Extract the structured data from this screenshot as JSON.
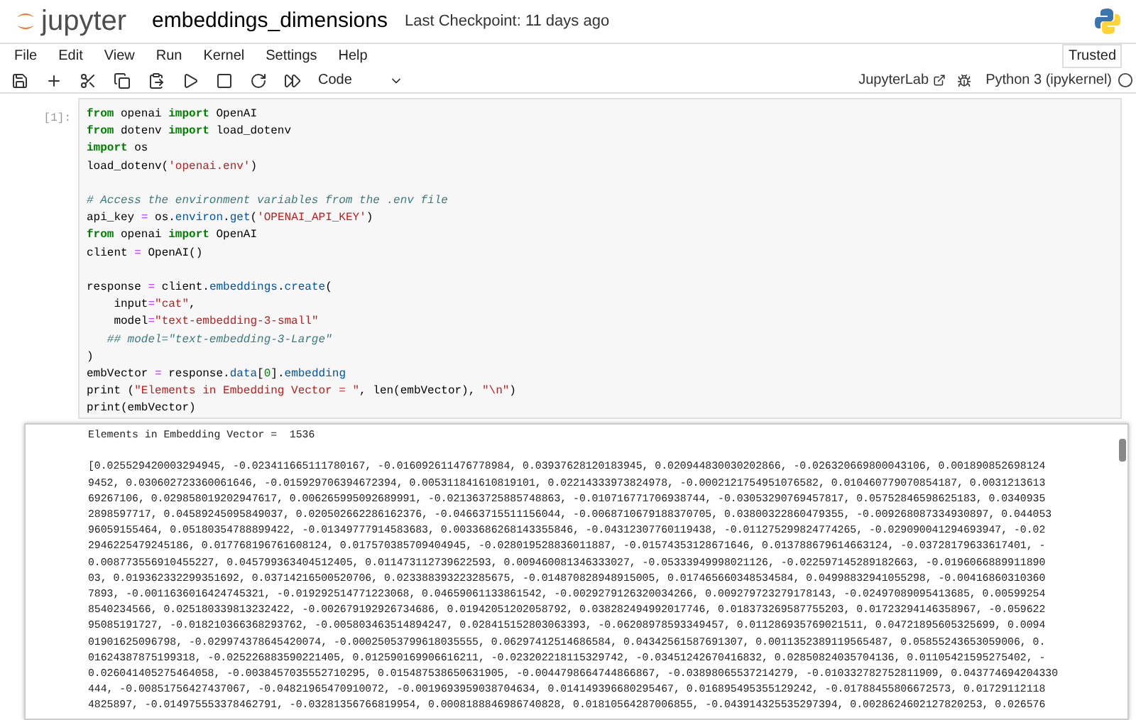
{
  "header": {
    "logo_text": "jupyter",
    "notebook_title": "embeddings_dimensions",
    "checkpoint": "Last Checkpoint: 11 days ago"
  },
  "menu": [
    "File",
    "Edit",
    "View",
    "Run",
    "Kernel",
    "Settings",
    "Help"
  ],
  "trusted": "Trusted",
  "toolbar": {
    "cell_type": "Code",
    "jupyterlab": "JupyterLab",
    "kernel": "Python 3 (ipykernel)"
  },
  "cell": {
    "prompt": "[1]:",
    "lines": [
      {
        "kind": "code",
        "tokens": [
          {
            "text": "from",
            "kind": "kw"
          },
          {
            "text": " openai ",
            "kind": "plain"
          },
          {
            "text": "import",
            "kind": "kw"
          },
          {
            "text": " OpenAI",
            "kind": "plain"
          }
        ]
      },
      {
        "kind": "code",
        "tokens": [
          {
            "text": "from",
            "kind": "kw"
          },
          {
            "text": " dotenv ",
            "kind": "plain"
          },
          {
            "text": "import",
            "kind": "kw"
          },
          {
            "text": " load_dotenv",
            "kind": "plain"
          }
        ]
      },
      {
        "kind": "code",
        "tokens": [
          {
            "text": "import",
            "kind": "kw"
          },
          {
            "text": " os",
            "kind": "plain"
          }
        ]
      },
      {
        "kind": "code",
        "tokens": [
          {
            "text": "load_dotenv(",
            "kind": "plain"
          },
          {
            "text": "'openai.env'",
            "kind": "str"
          },
          {
            "text": ")",
            "kind": "plain"
          }
        ]
      },
      {
        "kind": "blank"
      },
      {
        "kind": "code",
        "tokens": [
          {
            "text": "# Access the environment variables from the .env file",
            "kind": "comment"
          }
        ]
      },
      {
        "kind": "code",
        "tokens": [
          {
            "text": "api_key ",
            "kind": "plain"
          },
          {
            "text": "=",
            "kind": "op"
          },
          {
            "text": " os.",
            "kind": "plain"
          },
          {
            "text": "environ",
            "kind": "attr"
          },
          {
            "text": ".",
            "kind": "plain"
          },
          {
            "text": "get",
            "kind": "attr"
          },
          {
            "text": "(",
            "kind": "plain"
          },
          {
            "text": "'OPENAI_API_KEY'",
            "kind": "str"
          },
          {
            "text": ")",
            "kind": "plain"
          }
        ]
      },
      {
        "kind": "code",
        "tokens": [
          {
            "text": "from",
            "kind": "kw"
          },
          {
            "text": " openai ",
            "kind": "plain"
          },
          {
            "text": "import",
            "kind": "kw"
          },
          {
            "text": " OpenAI",
            "kind": "plain"
          }
        ]
      },
      {
        "kind": "code",
        "tokens": [
          {
            "text": "client ",
            "kind": "plain"
          },
          {
            "text": "=",
            "kind": "op"
          },
          {
            "text": " OpenAI()",
            "kind": "plain"
          }
        ]
      },
      {
        "kind": "blank"
      },
      {
        "kind": "code",
        "tokens": [
          {
            "text": "response ",
            "kind": "plain"
          },
          {
            "text": "=",
            "kind": "op"
          },
          {
            "text": " client.",
            "kind": "plain"
          },
          {
            "text": "embeddings",
            "kind": "attr"
          },
          {
            "text": ".",
            "kind": "plain"
          },
          {
            "text": "create",
            "kind": "attr"
          },
          {
            "text": "(",
            "kind": "plain"
          }
        ]
      },
      {
        "kind": "code",
        "tokens": [
          {
            "text": "    input",
            "kind": "plain"
          },
          {
            "text": "=",
            "kind": "op"
          },
          {
            "text": "\"cat\"",
            "kind": "str"
          },
          {
            "text": ",",
            "kind": "plain"
          }
        ]
      },
      {
        "kind": "code",
        "tokens": [
          {
            "text": "    model",
            "kind": "plain"
          },
          {
            "text": "=",
            "kind": "op"
          },
          {
            "text": "\"text-embedding-3-small\"",
            "kind": "str"
          }
        ]
      },
      {
        "kind": "code",
        "tokens": [
          {
            "text": "   ## model=\"text-embedding-3-Large\"",
            "kind": "comment"
          }
        ]
      },
      {
        "kind": "code",
        "tokens": [
          {
            "text": ")",
            "kind": "plain"
          }
        ]
      },
      {
        "kind": "code",
        "tokens": [
          {
            "text": "embVector ",
            "kind": "plain"
          },
          {
            "text": "=",
            "kind": "op"
          },
          {
            "text": " response.",
            "kind": "plain"
          },
          {
            "text": "data",
            "kind": "attr"
          },
          {
            "text": "[",
            "kind": "plain"
          },
          {
            "text": "0",
            "kind": "num"
          },
          {
            "text": "].",
            "kind": "plain"
          },
          {
            "text": "embedding",
            "kind": "attr"
          }
        ]
      },
      {
        "kind": "code",
        "tokens": [
          {
            "text": "print (",
            "kind": "plain"
          },
          {
            "text": "\"Elements in Embedding Vector = \"",
            "kind": "str"
          },
          {
            "text": ", len(embVector), ",
            "kind": "plain"
          },
          {
            "text": "\"\\n\"",
            "kind": "str"
          },
          {
            "text": ")",
            "kind": "plain"
          }
        ]
      },
      {
        "kind": "code",
        "tokens": [
          {
            "text": "print(embVector)",
            "kind": "plain"
          }
        ]
      }
    ]
  },
  "output": {
    "summary": "Elements in Embedding Vector =  1536",
    "lines": [
      "[0.025529420003294945, -0.023411665111780167, -0.016092611476778984, 0.03937628120183945, 0.020944830030202866, -0.026320669800043106, 0.001890852698124",
      "9452, 0.030602723360061646, -0.015929706394672394, 0.005311841610819101, 0.02214333973824978, -0.0002121754951076582, 0.010460779070854187, 0.0031213613",
      "69267106, 0.029858019202947617, 0.006265995092689991, -0.021363725885748863, -0.010716771706938744, -0.03053290769457817, 0.05752846598625183, 0.0340935",
      "2898597717, 0.04589245095849037, 0.020502662286162376, -0.04663715511156044, -0.0068710679188370705, 0.03800322860479355, -0.009268087334930897, 0.044053",
      "96059155464, 0.05180354788899422, -0.01349777914583683, 0.0033686268143355846, -0.04312307760119438, -0.011275299824774265, -0.029090041294693947, -0.02",
      "2946225479245186, 0.017768196761608124, 0.017570385709404945, -0.028019528836011887, -0.01574353128671646, 0.013788679614663124, -0.03728179633617401, -",
      "0.008773556910455227, 0.045799363404512405, 0.011473112739622593, 0.009460081346333027, -0.05333949998021126, -0.022597145289182663, -0.0196066889911890",
      "03, 0.019362332299351692, 0.03714216500520706, 0.023388393223285675, -0.014870828948915005, 0.017465660348534584, 0.04998832941055298, -0.00416860310360",
      "7893, -0.0011636016424745321, -0.019292514771223068, 0.04659061133861542, -0.0029279126320034266, 0.009279723279178143, -0.02497089095413685, 0.00599254",
      "8540234566, 0.025180339813232422, -0.002679192926734686, 0.01942051202058792, 0.038282494992017746, 0.018373269587755203, 0.01723294146358967, -0.059622",
      "95085191727, -0.018210366368293762, -0.005803463514894247, 0.028415152803063393, -0.06208978593349457, 0.011286935769021511, 0.04721895605325699, 0.0094",
      "01901625096798, -0.029974378645420074, -0.00025053799618035555, 0.06297412514686584, 0.04342561587691307, 0.0011352389119565487, 0.05855243653059006, 0.",
      "01624387875199318, -0.025226883590221405, 0.012590169906616211, -0.023202218115329742, -0.03451242670416832, 0.02850824035704136, 0.01105421595275402, -",
      "0.026041405275464058, -0.0038457035552710295, 0.015487538650631905, -0.0044798664744866867, -0.03898065537214279, -0.010332782752811909, 0.043774694204330",
      "444, -0.00851756427437067, -0.04821965470910072, -0.0019693959038704634, 0.014149396680295467, 0.016895495355129242, -0.01788455806672573, 0.01729112118",
      "4825897, -0.014975553378462791, -0.03281356766819954, 0.0008188846986740828, 0.01810564287006855, -0.043914325535297394, 0.0028624602127820253, 0.026576"
    ]
  }
}
